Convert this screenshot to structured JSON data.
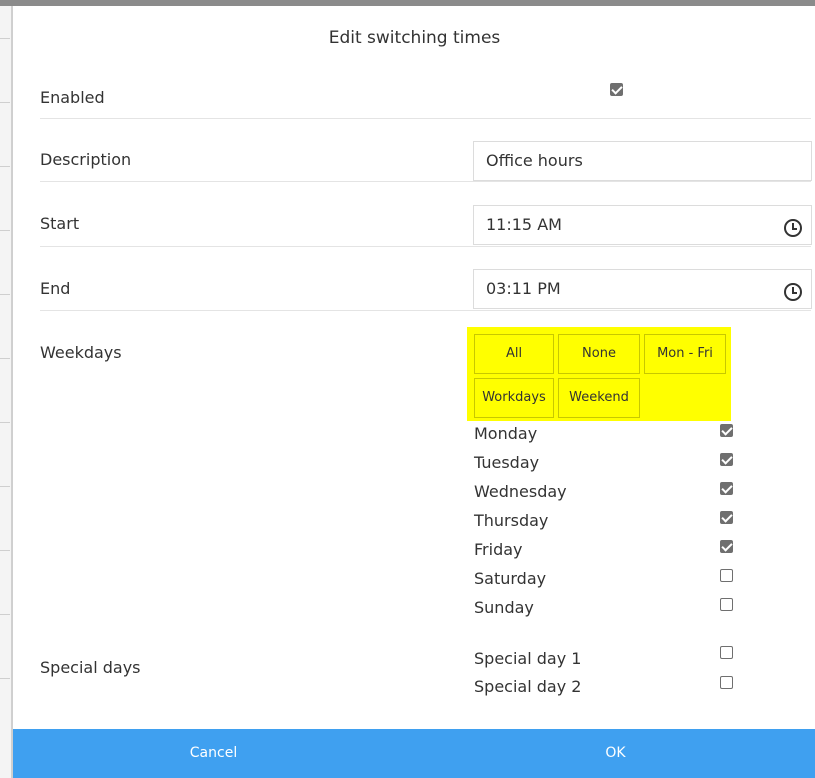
{
  "dialog": {
    "title": "Edit switching times"
  },
  "form": {
    "enabled": {
      "label": "Enabled",
      "checked": true
    },
    "description": {
      "label": "Description",
      "value": "Office hours"
    },
    "start": {
      "label": "Start",
      "value": "11:15 AM"
    },
    "end": {
      "label": "End",
      "value": "03:11 PM"
    },
    "weekdays": {
      "label": "Weekdays",
      "buttons": {
        "all": "All",
        "none": "None",
        "mon_fri": "Mon - Fri",
        "workdays": "Workdays",
        "weekend": "Weekend"
      },
      "days": [
        {
          "name": "Monday",
          "checked": true
        },
        {
          "name": "Tuesday",
          "checked": true
        },
        {
          "name": "Wednesday",
          "checked": true
        },
        {
          "name": "Thursday",
          "checked": true
        },
        {
          "name": "Friday",
          "checked": true
        },
        {
          "name": "Saturday",
          "checked": false
        },
        {
          "name": "Sunday",
          "checked": false
        }
      ]
    },
    "special_days": {
      "label": "Special days",
      "days": [
        {
          "name": "Special day 1",
          "checked": false
        },
        {
          "name": "Special day 2",
          "checked": false
        }
      ]
    }
  },
  "footer": {
    "cancel_label": "Cancel",
    "ok_label": "OK"
  },
  "colors": {
    "accent": "#3fa0f0",
    "highlight": "#ffff00"
  }
}
